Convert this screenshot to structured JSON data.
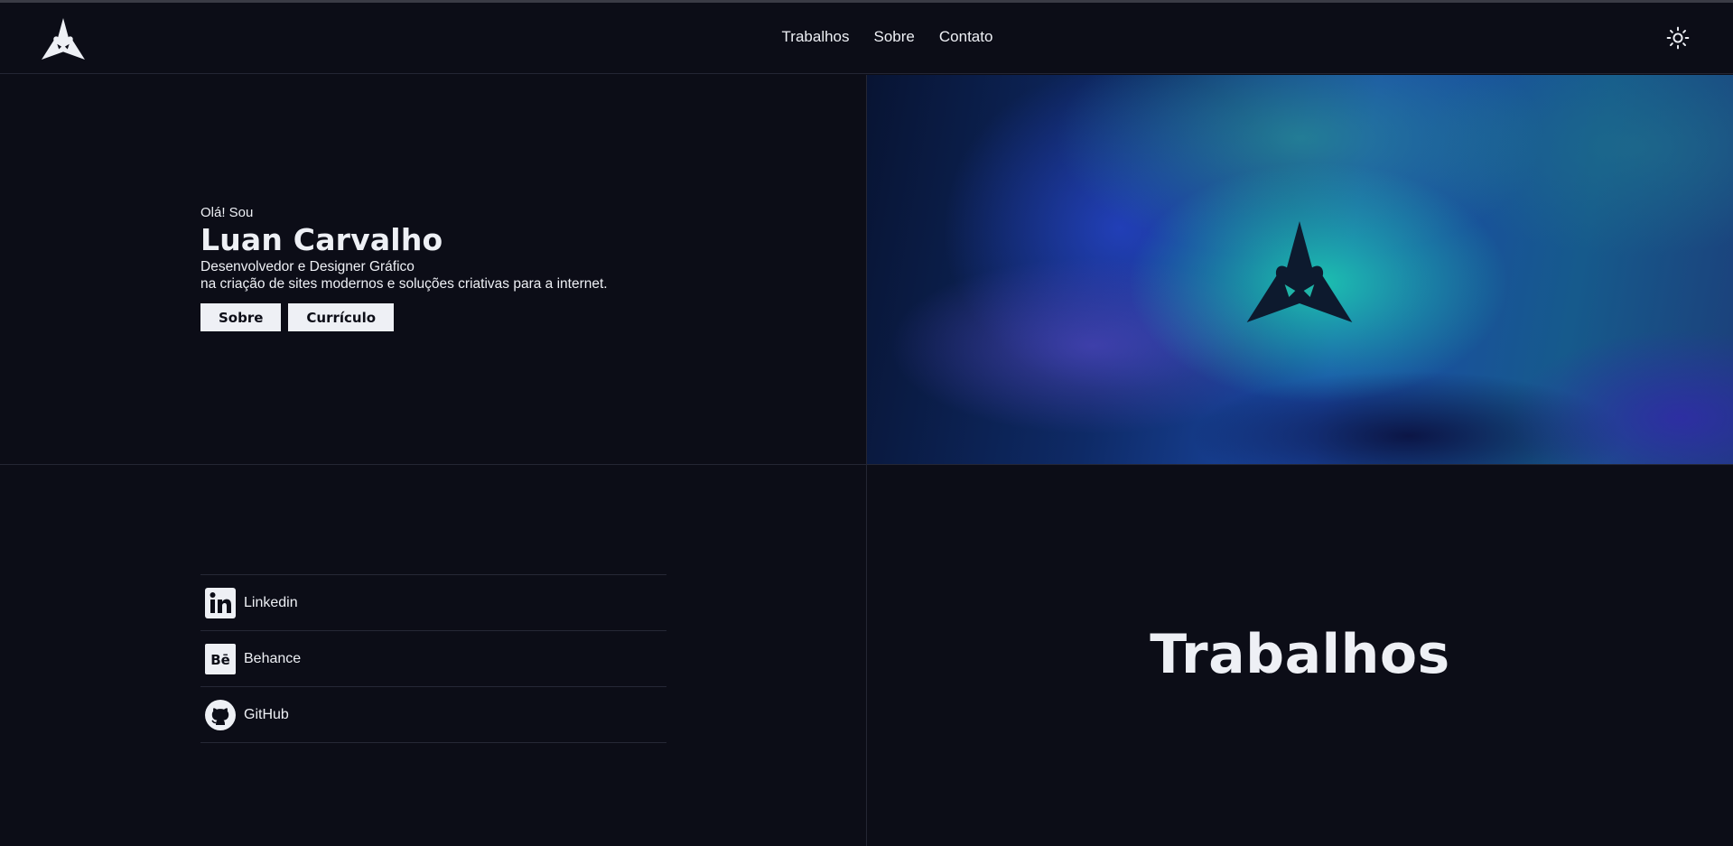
{
  "nav": {
    "links": [
      "Trabalhos",
      "Sobre",
      "Contato"
    ]
  },
  "hero": {
    "greeting": "Olá! Sou",
    "name": "Luan Carvalho",
    "role": "Desenvolvedor e Designer Gráfico",
    "tagline": "na criação de sites modernos e soluções criativas para a internet.",
    "buttons": [
      "Sobre",
      "Currículo"
    ]
  },
  "social": [
    {
      "label": "Linkedin",
      "icon": "linkedin-icon"
    },
    {
      "label": "Behance",
      "icon": "behance-icon"
    },
    {
      "label": "GitHub",
      "icon": "github-icon"
    }
  ],
  "works": {
    "title": "Trabalhos"
  },
  "colors": {
    "background": "#0c0d17",
    "text": "#eef0f5",
    "divider": "#242634",
    "accent_teal": "#1dd6b2",
    "accent_blue": "#1b4aa8"
  }
}
